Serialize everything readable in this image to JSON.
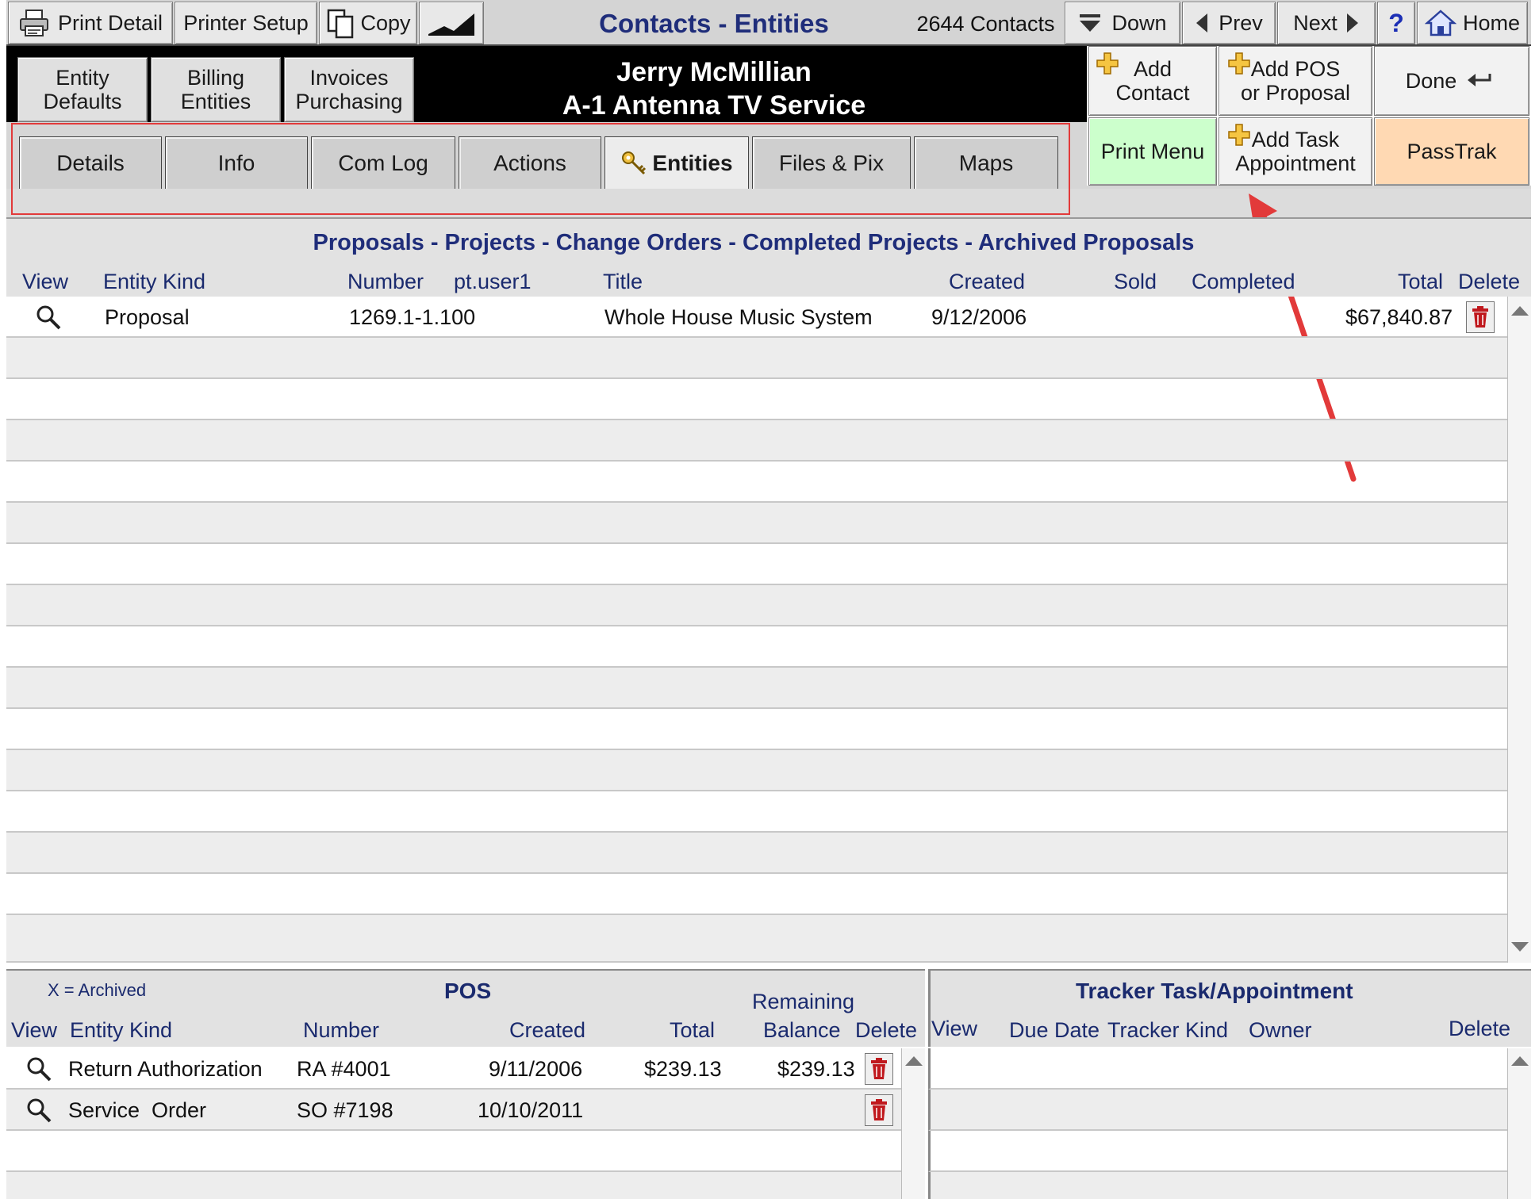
{
  "toolbar": {
    "print_detail": "Print Detail",
    "printer_setup": "Printer Setup",
    "copy": "Copy",
    "title": "Contacts - Entities",
    "contact_count": "2644 Contacts",
    "down": "Down",
    "prev": "Prev",
    "next": "Next",
    "help": "?",
    "home": "Home"
  },
  "subnav": {
    "entity_defaults": [
      "Entity",
      "Defaults"
    ],
    "billing_entities": [
      "Billing",
      "Entities"
    ],
    "invoices_purchasing": [
      "Invoices",
      "Purchasing"
    ]
  },
  "record": {
    "name": "Jerry McMillian",
    "company": "A-1 Antenna TV Service"
  },
  "actions": {
    "add_contact": [
      "Add",
      "Contact"
    ],
    "add_pos": [
      "Add POS",
      "or Proposal"
    ],
    "done": "Done",
    "print_menu": "Print Menu",
    "add_task": [
      "Add Task",
      "Appointment"
    ],
    "passtrak": "PassTrak"
  },
  "colors": {
    "print_menu_bg": "#ccffcc",
    "passtrak_bg": "#ffd9b3",
    "title_blue": "#1f2d7a",
    "annotation_red": "#e23a3a"
  },
  "tabs": [
    "Details",
    "Info",
    "Com Log",
    "Actions",
    "Entities",
    "Files & Pix",
    "Maps"
  ],
  "active_tab": "Entities",
  "proposals": {
    "title": "Proposals - Projects - Change Orders - Completed Projects - Archived Proposals",
    "columns": {
      "view": "View",
      "entity_kind": "Entity Kind",
      "number": "Number",
      "pt_user1": "pt.user1",
      "title": "Title",
      "created": "Created",
      "sold": "Sold",
      "completed": "Completed",
      "total": "Total",
      "delete": "Delete"
    },
    "rows": [
      {
        "entity_kind": "Proposal",
        "number": "1269.1-1.100",
        "title": "Whole House Music System",
        "created": "9/12/2006",
        "total": "$67,840.87"
      }
    ]
  },
  "pos": {
    "legend": "X = Archived",
    "title": "POS",
    "columns": {
      "view": "View",
      "entity_kind": "Entity Kind",
      "number": "Number",
      "created": "Created",
      "total": "Total",
      "remaining": "Remaining",
      "balance": "Balance",
      "delete": "Delete"
    },
    "rows": [
      {
        "entity_kind": "Return Authorization",
        "number": "RA #4001",
        "created": "9/11/2006",
        "total": "$239.13",
        "balance": "$239.13"
      },
      {
        "entity_kind": "Service  Order",
        "number": "SO #7198",
        "created": "10/10/2011",
        "total": "",
        "balance": ""
      }
    ]
  },
  "tracker": {
    "title": "Tracker Task/Appointment",
    "columns": {
      "view": "View",
      "due_date": "Due Date",
      "tracker_kind": "Tracker Kind",
      "owner": "Owner",
      "delete": "Delete"
    }
  }
}
